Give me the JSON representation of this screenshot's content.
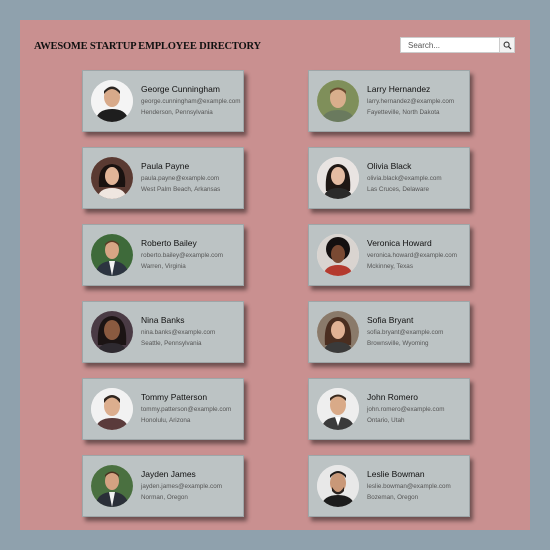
{
  "header": {
    "title": "Awesome Startup Employee Directory"
  },
  "search": {
    "placeholder": "Search...",
    "button_icon": "magnifier-icon"
  },
  "employees": [
    {
      "name": "George Cunningham",
      "email": "george.cunningham@example.com",
      "location": "Henderson, Pennsylvania"
    },
    {
      "name": "Larry Hernandez",
      "email": "larry.hernandez@example.com",
      "location": "Fayetteville, North Dakota"
    },
    {
      "name": "Paula Payne",
      "email": "paula.payne@example.com",
      "location": "West Palm Beach, Arkansas"
    },
    {
      "name": "Olivia Black",
      "email": "olivia.black@example.com",
      "location": "Las Cruces, Delaware"
    },
    {
      "name": "Roberto Bailey",
      "email": "roberto.bailey@example.com",
      "location": "Warren, Virginia"
    },
    {
      "name": "Veronica Howard",
      "email": "veronica.howard@example.com",
      "location": "Mckinney, Texas"
    },
    {
      "name": "Nina Banks",
      "email": "nina.banks@example.com",
      "location": "Seattle, Pennsylvania"
    },
    {
      "name": "Sofia Bryant",
      "email": "sofia.bryant@example.com",
      "location": "Brownsville, Wyoming"
    },
    {
      "name": "Tommy Patterson",
      "email": "tommy.patterson@example.com",
      "location": "Honolulu, Arizona"
    },
    {
      "name": "John Romero",
      "email": "john.romero@example.com",
      "location": "Ontario, Utah"
    },
    {
      "name": "Jayden James",
      "email": "jayden.james@example.com",
      "location": "Norman, Oregon"
    },
    {
      "name": "Leslie Bowman",
      "email": "leslie.bowman@example.com",
      "location": "Bozeman, Oregon"
    }
  ],
  "colors": {
    "outer_background": "#8fa1ad",
    "panel_background": "#c99090",
    "card_background": "#bcc3c4"
  }
}
